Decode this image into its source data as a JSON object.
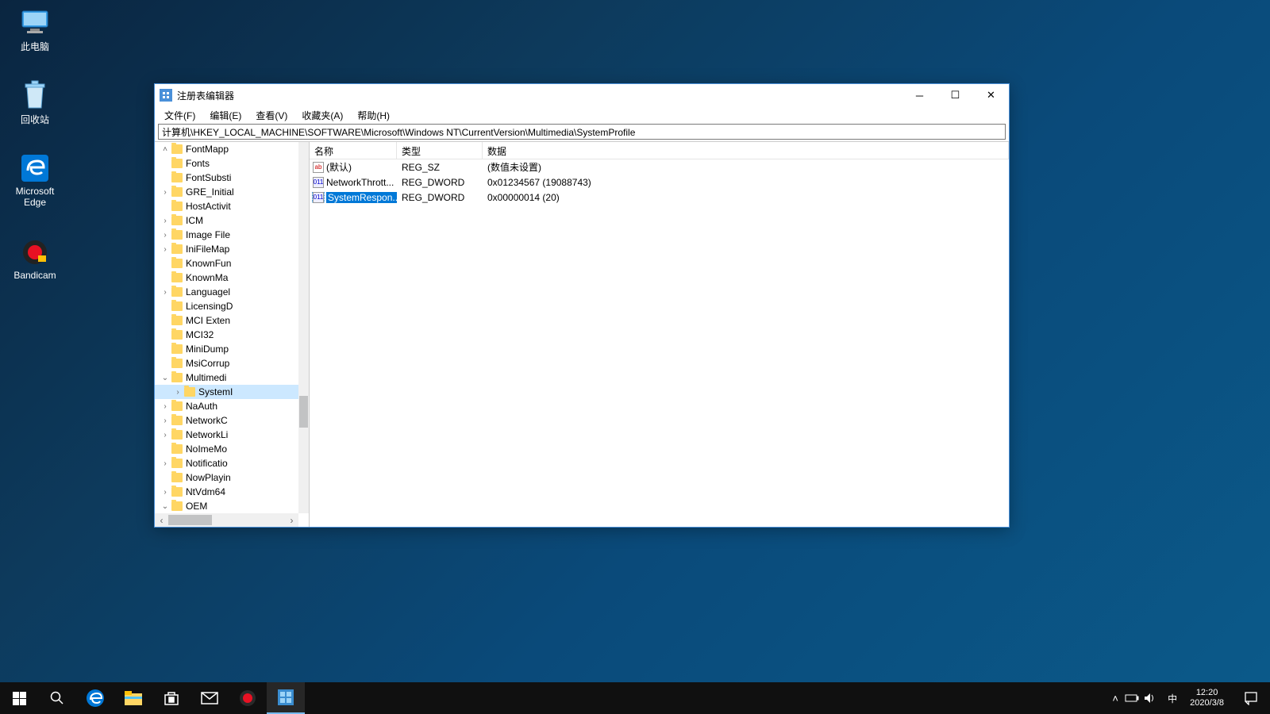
{
  "desktop_icons": {
    "pc": "此电脑",
    "recycle": "回收站",
    "edge1": "Microsoft",
    "edge2": "Edge",
    "bandicam": "Bandicam"
  },
  "window": {
    "title": "注册表编辑器",
    "menu": {
      "file": "文件(F)",
      "edit": "编辑(E)",
      "view": "查看(V)",
      "fav": "收藏夹(A)",
      "help": "帮助(H)"
    },
    "address": "计算机\\HKEY_LOCAL_MACHINE\\SOFTWARE\\Microsoft\\Windows NT\\CurrentVersion\\Multimedia\\SystemProfile",
    "columns": {
      "name": "名称",
      "type": "类型",
      "data": "数据"
    },
    "tree": [
      {
        "label": "FontMapp",
        "exp": "^",
        "indent": 0
      },
      {
        "label": "Fonts",
        "exp": "",
        "indent": 0
      },
      {
        "label": "FontSubsti",
        "exp": "",
        "indent": 0
      },
      {
        "label": "GRE_Initial",
        "exp": ">",
        "indent": 0
      },
      {
        "label": "HostActivit",
        "exp": "",
        "indent": 0
      },
      {
        "label": "ICM",
        "exp": ">",
        "indent": 0
      },
      {
        "label": "Image File",
        "exp": ">",
        "indent": 0
      },
      {
        "label": "IniFileMap",
        "exp": ">",
        "indent": 0
      },
      {
        "label": "KnownFun",
        "exp": "",
        "indent": 0
      },
      {
        "label": "KnownMa",
        "exp": "",
        "indent": 0
      },
      {
        "label": "Languagel",
        "exp": ">",
        "indent": 0
      },
      {
        "label": "LicensingD",
        "exp": "",
        "indent": 0
      },
      {
        "label": "MCI Exten",
        "exp": "",
        "indent": 0
      },
      {
        "label": "MCI32",
        "exp": "",
        "indent": 0
      },
      {
        "label": "MiniDump",
        "exp": "",
        "indent": 0
      },
      {
        "label": "MsiCorrup",
        "exp": "",
        "indent": 0
      },
      {
        "label": "Multimedi",
        "exp": "v",
        "indent": 0,
        "open": true
      },
      {
        "label": "SystemI",
        "exp": ">",
        "indent": 1,
        "selected": true
      },
      {
        "label": "NaAuth",
        "exp": ">",
        "indent": 0
      },
      {
        "label": "NetworkC",
        "exp": ">",
        "indent": 0
      },
      {
        "label": "NetworkLi",
        "exp": ">",
        "indent": 0
      },
      {
        "label": "NoImeMo",
        "exp": "",
        "indent": 0
      },
      {
        "label": "Notificatio",
        "exp": ">",
        "indent": 0
      },
      {
        "label": "NowPlayin",
        "exp": "",
        "indent": 0
      },
      {
        "label": "NtVdm64",
        "exp": ">",
        "indent": 0
      },
      {
        "label": "OEM",
        "exp": "v",
        "indent": 0
      }
    ],
    "values": [
      {
        "name": "(默认)",
        "type": "REG_SZ",
        "data": "(数值未设置)",
        "kind": "str"
      },
      {
        "name": "NetworkThrott...",
        "type": "REG_DWORD",
        "data": "0x01234567 (19088743)",
        "kind": "dword"
      },
      {
        "name": "SystemRespon...",
        "type": "REG_DWORD",
        "data": "0x00000014 (20)",
        "kind": "dword",
        "selected": true
      }
    ]
  },
  "taskbar": {
    "ime": "中",
    "time": "12:20",
    "date": "2020/3/8"
  }
}
